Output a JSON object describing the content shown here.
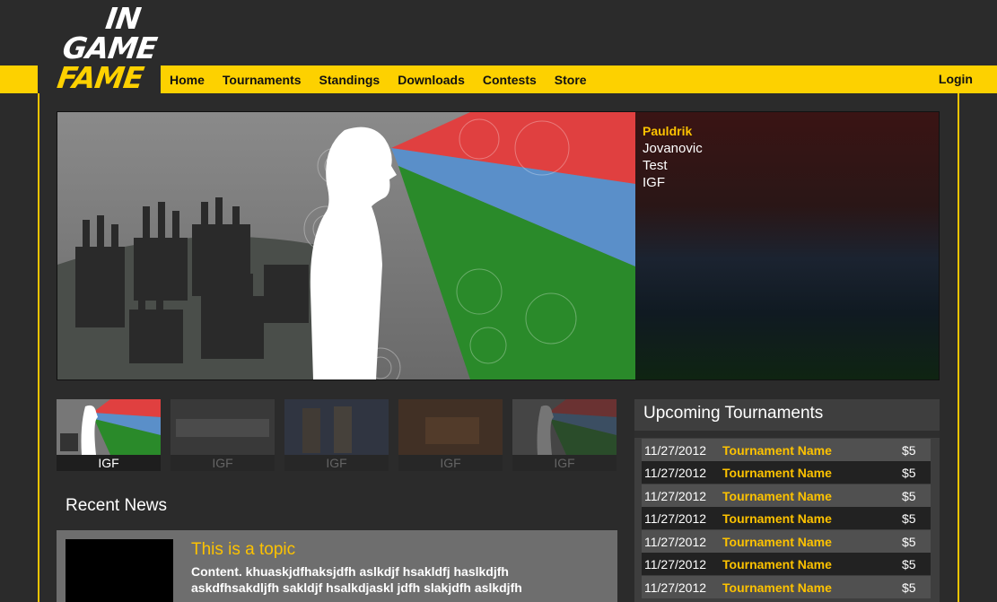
{
  "logo": {
    "line1": "IN",
    "line2": "GAME",
    "line3": "FAME"
  },
  "nav": {
    "items": [
      "Home",
      "Tournaments",
      "Standings",
      "Downloads",
      "Contests",
      "Store"
    ],
    "login": "Login"
  },
  "hero": {
    "name": "Pauldrik",
    "lines": [
      "Jovanovic",
      "Test",
      "IGF"
    ]
  },
  "thumbs": [
    "IGF",
    "IGF",
    "IGF",
    "IGF",
    "IGF"
  ],
  "news": {
    "heading": "Recent News",
    "topic": "This is a topic",
    "content": "Content. khuaskjdfhaksjdfh aslkdjf hsakldfj haslkdjfh askdfhsakdljfh sakldjf hsalkdjaskl jdfh slakjdfh aslkdjfh"
  },
  "upcoming": {
    "heading": "Upcoming Tournaments",
    "rows": [
      {
        "date": "11/27/2012",
        "name": "Tournament Name",
        "fee": "$5"
      },
      {
        "date": "11/27/2012",
        "name": "Tournament Name",
        "fee": "$5"
      },
      {
        "date": "11/27/2012",
        "name": "Tournament Name",
        "fee": "$5"
      },
      {
        "date": "11/27/2012",
        "name": "Tournament Name",
        "fee": "$5"
      },
      {
        "date": "11/27/2012",
        "name": "Tournament Name",
        "fee": "$5"
      },
      {
        "date": "11/27/2012",
        "name": "Tournament Name",
        "fee": "$5"
      },
      {
        "date": "11/27/2012",
        "name": "Tournament Name",
        "fee": "$5"
      }
    ]
  },
  "colors": {
    "accent": "#fdd100",
    "highlight": "#fdc200",
    "background": "#2b2b2b"
  }
}
